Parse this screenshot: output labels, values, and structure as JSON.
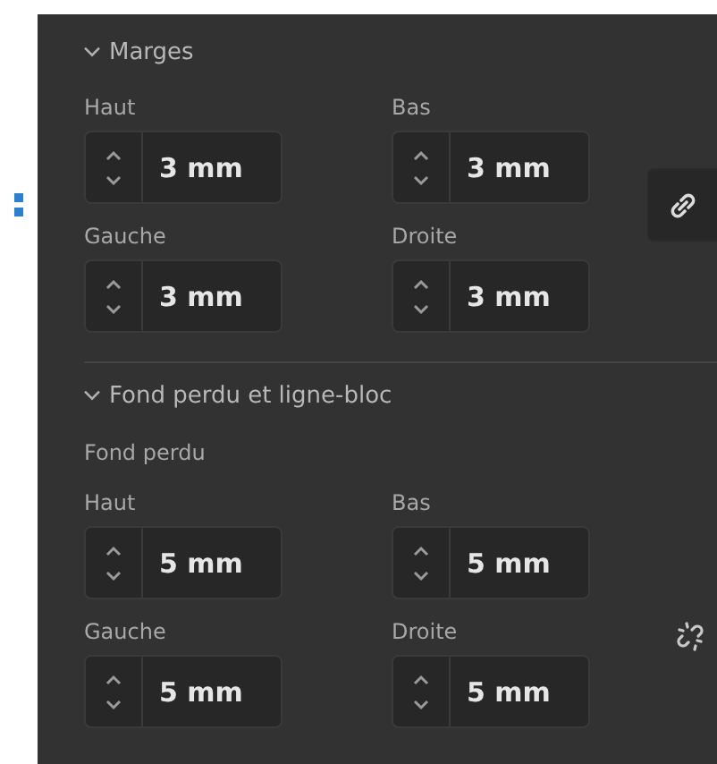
{
  "sections": [
    {
      "title": "Marges",
      "expanded": true,
      "linked": true,
      "fields": [
        {
          "label": "Haut",
          "value": "3 mm"
        },
        {
          "label": "Bas",
          "value": "3 mm"
        },
        {
          "label": "Gauche",
          "value": "3 mm"
        },
        {
          "label": "Droite",
          "value": "3 mm"
        }
      ]
    },
    {
      "title": "Fond perdu et ligne-bloc",
      "expanded": true,
      "subtitle": "Fond perdu",
      "linked": false,
      "fields": [
        {
          "label": "Haut",
          "value": "5 mm"
        },
        {
          "label": "Bas",
          "value": "5 mm"
        },
        {
          "label": "Gauche",
          "value": "5 mm"
        },
        {
          "label": "Droite",
          "value": "5 mm"
        }
      ]
    }
  ]
}
